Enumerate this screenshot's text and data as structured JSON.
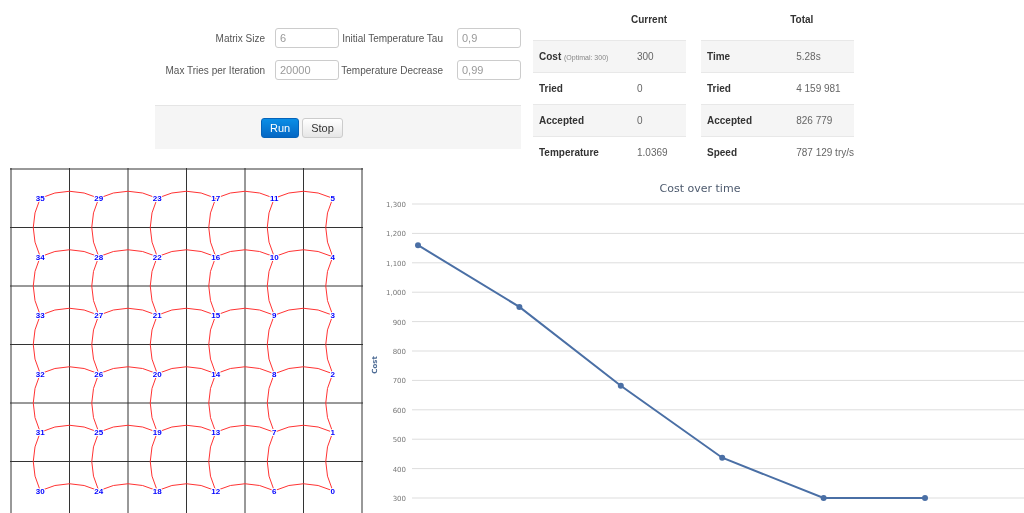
{
  "form": {
    "fields": [
      {
        "label": "Matrix Size",
        "value": "6"
      },
      {
        "label": "Initial Temperature Tau",
        "value": "0,9"
      },
      {
        "label": "Max Tries per Iteration",
        "value": "20000"
      },
      {
        "label": "Temperature Decrease",
        "value": "0,99"
      }
    ],
    "buttons": [
      {
        "label": "Run",
        "kind": "primary"
      },
      {
        "label": "Stop",
        "kind": "default"
      }
    ]
  },
  "stats": [
    {
      "title": "Current",
      "rows": [
        {
          "label": "Cost",
          "note": "(Optimal: 300)",
          "value": "300"
        },
        {
          "label": "Tried",
          "value": "0"
        },
        {
          "label": "Accepted",
          "value": "0"
        },
        {
          "label": "Temperature",
          "value": "1.0369"
        }
      ]
    },
    {
      "title": "Total",
      "rows": [
        {
          "label": "Time",
          "value": "5.28s"
        },
        {
          "label": "Tried",
          "value": "4 159 981"
        },
        {
          "label": "Accepted",
          "value": "826 779"
        },
        {
          "label": "Speed",
          "value": "787 129 try/s"
        }
      ]
    }
  ],
  "grid": {
    "rows": [
      [
        "35",
        "29",
        "23",
        "17",
        "11",
        "5"
      ],
      [
        "34",
        "28",
        "22",
        "16",
        "10",
        "4"
      ],
      [
        "33",
        "27",
        "21",
        "15",
        "9",
        "3"
      ],
      [
        "32",
        "26",
        "20",
        "14",
        "8",
        "2"
      ],
      [
        "31",
        "25",
        "19",
        "13",
        "7",
        "1"
      ],
      [
        "30",
        "24",
        "18",
        "12",
        "6",
        "0"
      ]
    ]
  },
  "chart": {
    "chart_data": {
      "type": "line",
      "title": "Cost over time",
      "ylabel": "Cost",
      "grid": true,
      "series": [
        {
          "color": "#4a6fa5",
          "marker": true,
          "values": [
            1160,
            950,
            682,
            437,
            300,
            300
          ]
        }
      ],
      "ylim": [
        300,
        1300
      ],
      "yticks": [
        {
          "value": 300,
          "label": "300"
        },
        {
          "value": 400,
          "label": "400"
        },
        {
          "value": 500,
          "label": "500"
        },
        {
          "value": 600,
          "label": "600"
        },
        {
          "value": 700,
          "label": "700"
        },
        {
          "value": 800,
          "label": "800"
        },
        {
          "value": 900,
          "label": "900"
        },
        {
          "value": 1000,
          "label": "1,000"
        },
        {
          "value": 1100,
          "label": "1,100"
        },
        {
          "value": 1200,
          "label": "1,200"
        },
        {
          "value": 1300,
          "label": "1,300"
        }
      ]
    }
  }
}
